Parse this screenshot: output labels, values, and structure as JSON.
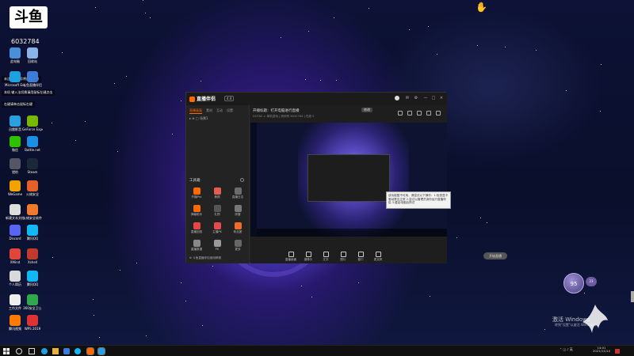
{
  "overlay": {
    "logo_text": "斗鱼",
    "room_number": "6032784",
    "notice_1": "未注册的账号将自动注册",
    "notice_2": "本机 输入法切换请用鼠标左键点击",
    "notice_3": "右键请单击鼠标右键"
  },
  "desktop_icons": [
    {
      "label": "此电脑",
      "color": "#4a90d9"
    },
    {
      "label": "回收站",
      "color": "#8ab4e8"
    },
    {
      "label": "Microsoft Edge",
      "color": "#1fa0e0"
    },
    {
      "label": "斗鱼直播伴侣",
      "color": "#3d7dd8"
    },
    {
      "label": "迅雷影音",
      "color": "#2aa0e0"
    },
    {
      "label": "GeForce Experience",
      "color": "#76b900"
    },
    {
      "label": "微信",
      "color": "#2dc100"
    },
    {
      "label": "Battle.net",
      "color": "#1a8fe3"
    },
    {
      "label": "猎豹",
      "color": "#556"
    },
    {
      "label": "Steam",
      "color": "#1b2838"
    },
    {
      "label": "WeGame",
      "color": "#f2a300"
    },
    {
      "label": "火绒安全",
      "color": "#e6602a"
    },
    {
      "label": "新建文本文档",
      "color": "#ddd"
    },
    {
      "label": "火绒安全软件",
      "color": "#f07a2b"
    },
    {
      "label": "Discord",
      "color": "#5865f2"
    },
    {
      "label": "腾讯QQ",
      "color": "#12b7f5"
    },
    {
      "label": "XMind",
      "color": "#e0463b"
    },
    {
      "label": "Xshell",
      "color": "#c0392b"
    },
    {
      "label": "个人简历",
      "color": "#d9d9d9"
    },
    {
      "label": "腾讯QQ",
      "color": "#12b7f5"
    },
    {
      "label": "工作文件",
      "color": "#eee"
    },
    {
      "label": "360安全卫士",
      "color": "#2ea84a"
    },
    {
      "label": "腾讯视频",
      "color": "#ff7a00"
    },
    {
      "label": "WPS 2019",
      "color": "#d33"
    },
    {
      "label": "NVIDIA Online",
      "color": "#76b900"
    }
  ],
  "app": {
    "brand": "直播伴侣",
    "version": "4.0",
    "window_controls": [
      "—",
      "□",
      "×"
    ],
    "left_tabs": [
      "直播画面",
      "素材",
      "互动",
      "设置"
    ],
    "scene_label": "场景1",
    "tools_title": "工具箱",
    "tools": [
      {
        "label": "开播Pro",
        "color": "#ff6a00"
      },
      {
        "label": "美颜",
        "color": "#e45b4f"
      },
      {
        "label": "直播日志",
        "color": "#6c6c6c"
      },
      {
        "label": "弹幕助手",
        "color": "#ff6a00"
      },
      {
        "label": "礼物",
        "color": "#555"
      },
      {
        "label": "房管",
        "color": "#777"
      },
      {
        "label": "直播回放",
        "color": "#e84545"
      },
      {
        "label": "主播PK",
        "color": "#e64b4b"
      },
      {
        "label": "粉丝团",
        "color": "#ef6b2b"
      },
      {
        "label": "直播数据",
        "color": "#888"
      },
      {
        "label": "PK",
        "color": "#999"
      },
      {
        "label": "更多",
        "color": "#666"
      }
    ],
    "left_footer": "⊕ 斗鱼直播伴侣使用教程",
    "main_title": "开播标题：打开电脑进行直播",
    "main_title_button": "修改",
    "main_sub": "DOTA2 > 单机游戏   |   房间号 6032784   |   在线 0",
    "controls": [
      "直播画面",
      "摄像头",
      "文字",
      "图片",
      "窗口",
      "麦克风"
    ],
    "go_live_label": "开始直播",
    "tooltip_text": "该功能暂不可用，请尝试以下操作：1.检查显卡驱动是否正常 2.尝试以管理员身份运行直播伴侣 3.重启电脑后再试"
  },
  "widgets": {
    "bubble_value": "95",
    "bubble2_value": "23",
    "activate_title": "激活 Windows",
    "activate_sub": "转到\"设置\"以激活 Windows。"
  },
  "taskbar": {
    "tray_time": "14:01",
    "tray_date": "2021/11/14",
    "tray_lang": "英"
  }
}
